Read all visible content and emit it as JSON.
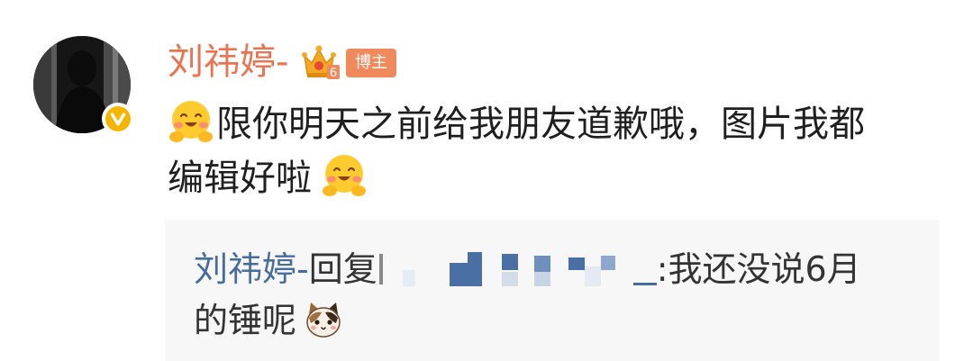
{
  "comment": {
    "author": "刘祎婷-",
    "badge_label": "博主",
    "crown_level": "6",
    "text_line1": "限你明天之前给我朋友道歉哦，图片我都",
    "text_line2": "编辑好啦",
    "icons": {
      "avatar": "avatar-photo",
      "verified": "verified-v-icon",
      "crown": "crown-icon",
      "emoji": "smiley-hug-emoji"
    },
    "colors": {
      "author": "#eb7350",
      "badge": "#f08a5d",
      "reply_author": "#476c9e",
      "reply_bg": "#f7f7f7"
    }
  },
  "reply": {
    "author": "刘祎婷-",
    "verb": "回复",
    "text_line1": ":我还没说6月",
    "text_line2": "的锤呢",
    "emoji": "cat-emoji"
  }
}
